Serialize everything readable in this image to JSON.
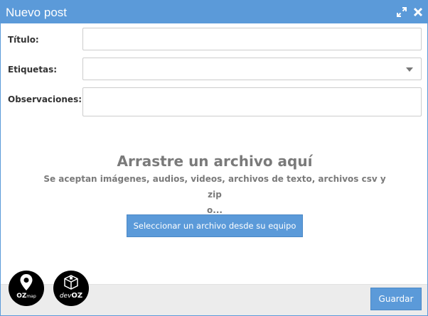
{
  "dialog": {
    "title": "Nuevo post",
    "header_icons": [
      "expand-icon",
      "close-icon"
    ]
  },
  "form": {
    "title_label": "Título:",
    "title_value": "",
    "tags_label": "Etiquetas:",
    "tags_value": "",
    "notes_label": "Observaciones:",
    "notes_value": ""
  },
  "dropzone": {
    "heading": "Arrastre un archivo aquí",
    "accepted_text": "Se aceptan imágenes, audios, videos, archivos de texto, archivos csv y zip",
    "or_text": "o...",
    "select_button": "Seleccionar un archivo desde su equipo"
  },
  "footer": {
    "save_button": "Guardar",
    "logos": {
      "ozmap": {
        "main": "OZ",
        "suffix": "map"
      },
      "devoz": {
        "prefix": "dev",
        "main": "OZ"
      }
    }
  },
  "colors": {
    "accent": "#5b9ad9",
    "heading_gray": "#7a7a7a",
    "footer_bg": "#ececec",
    "border": "#cccccc"
  }
}
